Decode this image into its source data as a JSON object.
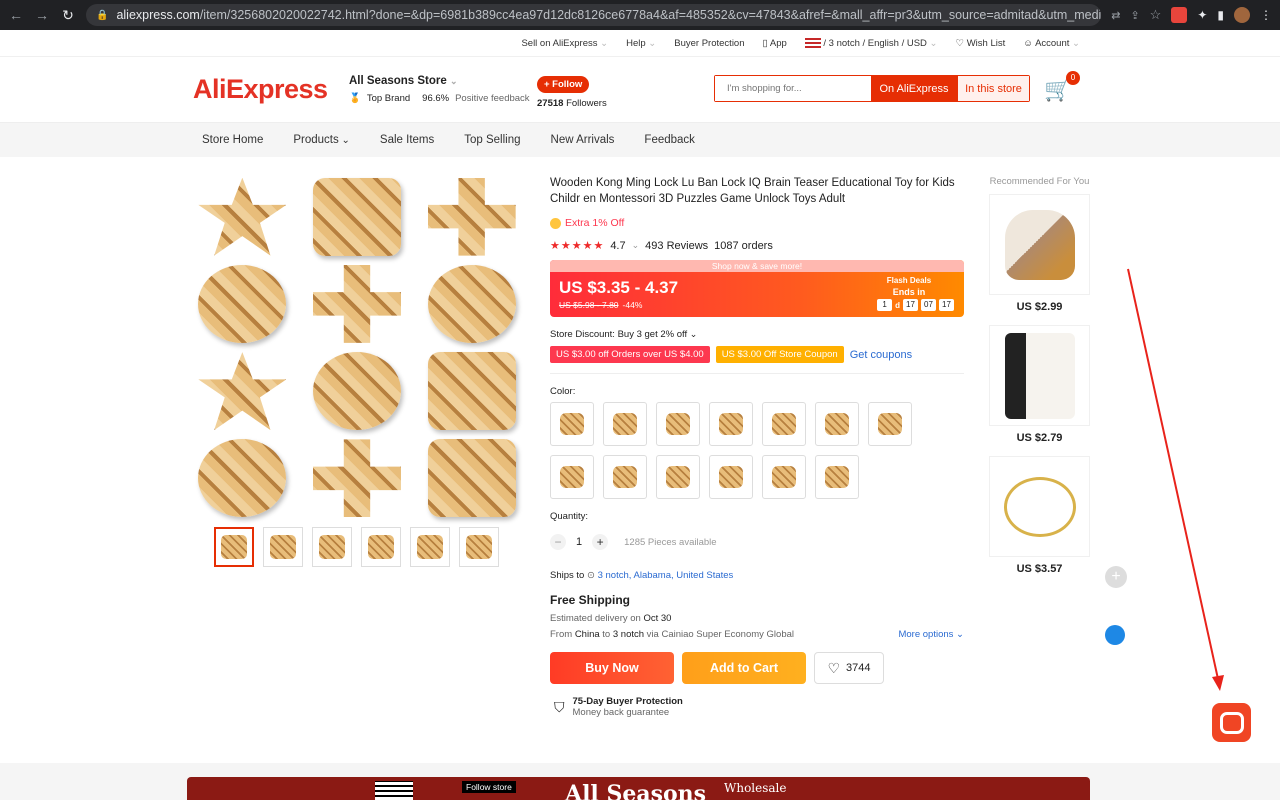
{
  "browser": {
    "url_host": "aliexpress.com",
    "url_rest": "/item/3256802020022742.html?done=&dp=6981b389cc4ea97d12dc8126ce6778a4&af=485352&cv=47843&afref=&mall_affr=pr3&utm_source=admitad&utm_medium=cpa&u..."
  },
  "topbar": {
    "sell": "Sell on AliExpress",
    "help": "Help",
    "protection": "Buyer Protection",
    "app": "App",
    "locale": "/ 3 notch / English / USD",
    "wishlist": "Wish List",
    "account": "Account"
  },
  "header": {
    "logo": "AliExpress",
    "store_name": "All Seasons Store",
    "top_brand": "Top Brand",
    "feedback_pct": "96.6%",
    "feedback_label": "Positive feedback",
    "follow_label": "+ Follow",
    "followers_count": "27518",
    "followers_label": "Followers",
    "search_placeholder": "I'm shopping for...",
    "search_all": "On AliExpress",
    "search_store": "In this store",
    "cart_count": "0"
  },
  "storenav": [
    "Store Home",
    "Products",
    "Sale Items",
    "Top Selling",
    "New Arrivals",
    "Feedback"
  ],
  "product": {
    "title": "Wooden Kong Ming Lock Lu Ban Lock IQ Brain Teaser Educational Toy for Kids Childr en Montessori 3D Puzzles Game Unlock Toys Adult",
    "extra_off": "Extra 1% Off",
    "stars": "★★★★★",
    "rating": "4.7",
    "reviews": "493 Reviews",
    "orders": "1087 orders",
    "banner": "Shop now & save more!",
    "price": "US $3.35 - 4.37",
    "old_price": "US $5.98 - 7.80",
    "discount_pct": "-44%",
    "flash_title": "Flash Deals",
    "ends_in": "Ends in",
    "timer": {
      "days": "1",
      "d_label": "d",
      "hours": "17",
      "minutes": "07",
      "seconds": "17"
    },
    "store_discount": "Store Discount: Buy 3 get 2% off",
    "coupon1": "US $3.00 off Orders over US $4.00",
    "coupon2": "US $3.00 Off Store Coupon",
    "get_coupons": "Get coupons",
    "color_label": "Color:",
    "quantity_label": "Quantity:",
    "quantity": "1",
    "available": "1285 Pieces available",
    "ships_to": "Ships to",
    "ships_location": "3 notch, Alabama, United States",
    "free_shipping": "Free Shipping",
    "est_delivery": "Estimated delivery on",
    "delivery_date": "Oct 30",
    "from_line_a": "From",
    "from_country": "China",
    "from_line_b": "to",
    "to_place": "3 notch",
    "via": "via Cainiao Super Economy Global",
    "more_options": "More options",
    "buy_now": "Buy Now",
    "add_to_cart": "Add to Cart",
    "wish_count": "3744",
    "protection_title": "75-Day Buyer Protection",
    "protection_sub": "Money back guarantee"
  },
  "recommended": {
    "header": "Recommended For You",
    "items": [
      {
        "price": "US $2.99"
      },
      {
        "price": "US $2.79"
      },
      {
        "price": "US $3.57"
      }
    ]
  },
  "store_banner": {
    "follow_store": "Follow store",
    "big": "All Seasons",
    "wholesale": "Wholesale"
  },
  "colors": {
    "brand": "#e62e04",
    "accent_orange": "#ffb000",
    "link": "#2b6bd1",
    "annotation_arrow": "#e8231b"
  }
}
